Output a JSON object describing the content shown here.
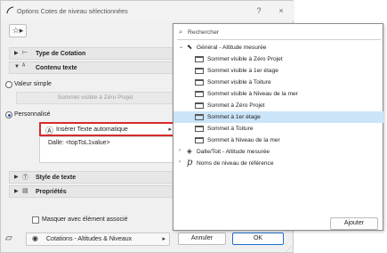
{
  "window": {
    "title": "Options Cotes de niveau sélectionnées",
    "help_label": "?",
    "close_label": "×"
  },
  "favorites": {
    "icon": "star-icon"
  },
  "sections": {
    "cotation_type": {
      "label": "Type de Cotation",
      "icon": "level-dimension-icon"
    },
    "content": {
      "label": "Contenu texte",
      "icon": "text-content-icon"
    },
    "text_style": {
      "label": "Style de texte",
      "icon": "text-style-icon"
    },
    "properties": {
      "label": "Propriétés",
      "icon": "properties-icon"
    }
  },
  "content": {
    "simple_value_label": "Valeur simple",
    "simple_value_field": "Sommet visible à Zéro Projet",
    "custom_label": "Personnalisé",
    "insert_auto_text_label": "Insérer Texte automatique",
    "custom_text": "Dalle: <topToL1value>"
  },
  "mask_checkbox_label": "Masquer avec élément associé",
  "layer": {
    "label": "Cotations - Altitudes & Niveaux"
  },
  "buttons": {
    "cancel": "Annuler",
    "ok": "OK",
    "add": "Ajouter"
  },
  "popup": {
    "search_placeholder": "Rechercher",
    "tree": [
      {
        "label": "Général - Altitude mesurée",
        "expanded": true,
        "items": [
          "Sommet visible à Zéro Projet",
          "Sommet visible à 1er étage",
          "Sommet visible à Toiture",
          "Sommet visible à Niveau de la mer",
          "Sommet à Zéro Projet",
          "Sommet à 1er étage",
          "Sommet à Toiture",
          "Sommet à Niveau de la mer"
        ],
        "selected_index": 5
      },
      {
        "label": "Dalle/Toit - Altitude mesurée",
        "expanded": false
      },
      {
        "label": "Noms de niveau de référence",
        "expanded": false
      }
    ]
  },
  "colors": {
    "highlight_border": "#d62b2b",
    "selection": "#cce4f7",
    "accent": "#1f57a8"
  }
}
